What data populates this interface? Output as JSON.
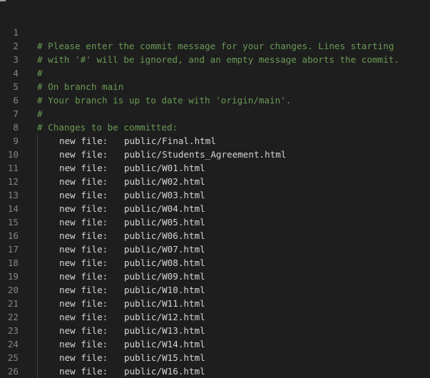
{
  "editor": {
    "language": "git-commit",
    "comment_color": "#6a9955",
    "text_color": "#d4d4d4",
    "line_number_color": "#858585",
    "background": "#1e1e1e",
    "lines": [
      {
        "n": "1",
        "text": "",
        "type": "blank"
      },
      {
        "n": "2",
        "text": "# Please enter the commit message for your changes. Lines starting",
        "type": "comment"
      },
      {
        "n": "3",
        "text": "# with '#' will be ignored, and an empty message aborts the commit.",
        "type": "comment"
      },
      {
        "n": "4",
        "text": "#",
        "type": "comment"
      },
      {
        "n": "5",
        "text": "# On branch main",
        "type": "comment"
      },
      {
        "n": "6",
        "text": "# Your branch is up to date with 'origin/main'.",
        "type": "comment"
      },
      {
        "n": "7",
        "text": "#",
        "type": "comment"
      },
      {
        "n": "8",
        "text": "# Changes to be committed:",
        "type": "comment"
      },
      {
        "n": "9",
        "label": "new file:",
        "path": "public/Final.html",
        "type": "change"
      },
      {
        "n": "10",
        "label": "new file:",
        "path": "public/Students_Agreement.html",
        "type": "change"
      },
      {
        "n": "11",
        "label": "new file:",
        "path": "public/W01.html",
        "type": "change"
      },
      {
        "n": "12",
        "label": "new file:",
        "path": "public/W02.html",
        "type": "change"
      },
      {
        "n": "13",
        "label": "new file:",
        "path": "public/W03.html",
        "type": "change"
      },
      {
        "n": "14",
        "label": "new file:",
        "path": "public/W04.html",
        "type": "change"
      },
      {
        "n": "15",
        "label": "new file:",
        "path": "public/W05.html",
        "type": "change"
      },
      {
        "n": "16",
        "label": "new file:",
        "path": "public/W06.html",
        "type": "change"
      },
      {
        "n": "17",
        "label": "new file:",
        "path": "public/W07.html",
        "type": "change"
      },
      {
        "n": "18",
        "label": "new file:",
        "path": "public/W08.html",
        "type": "change"
      },
      {
        "n": "19",
        "label": "new file:",
        "path": "public/W09.html",
        "type": "change"
      },
      {
        "n": "20",
        "label": "new file:",
        "path": "public/W10.html",
        "type": "change"
      },
      {
        "n": "21",
        "label": "new file:",
        "path": "public/W11.html",
        "type": "change"
      },
      {
        "n": "22",
        "label": "new file:",
        "path": "public/W12.html",
        "type": "change"
      },
      {
        "n": "23",
        "label": "new file:",
        "path": "public/W13.html",
        "type": "change"
      },
      {
        "n": "24",
        "label": "new file:",
        "path": "public/W14.html",
        "type": "change"
      },
      {
        "n": "25",
        "label": "new file:",
        "path": "public/W15.html",
        "type": "change"
      },
      {
        "n": "26",
        "label": "new file:",
        "path": "public/W16.html",
        "type": "change"
      }
    ]
  }
}
